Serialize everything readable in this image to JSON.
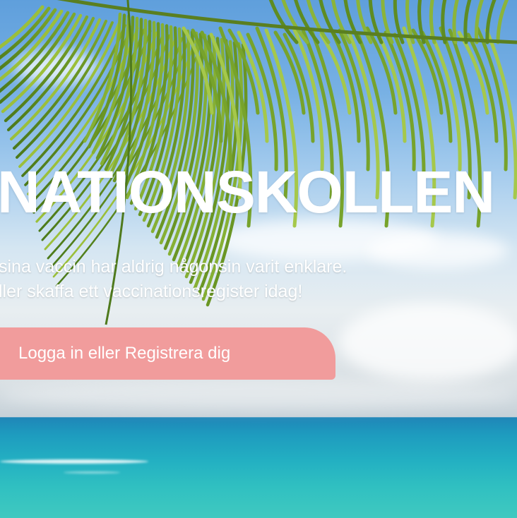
{
  "hero": {
    "title": "NATIONSKOLLEN",
    "subtitle_line1": "sina vaccin har aldrig någonsin varit enklare.",
    "subtitle_line2": "ller skaffa ett vaccinationsregister idag!",
    "cta_label": "Logga in eller Registrera dig",
    "background": "beach-with-palm-leaf-photo"
  },
  "colors": {
    "cta_background": "#f19c9c",
    "text": "#ffffff",
    "sky": "#78b1e4",
    "sea": "#23b0c2"
  }
}
